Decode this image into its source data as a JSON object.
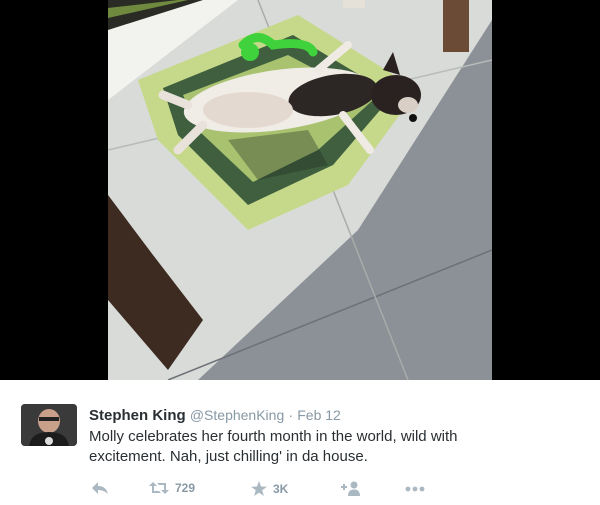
{
  "photo": {
    "description_icon": "photo-of-dog-sleeping-on-mat"
  },
  "tweet": {
    "author_name": "Stephen King",
    "author_handle": "@StephenKing",
    "separator": "·",
    "date": "Feb 12",
    "text_line1": "Molly celebrates her fourth month in the world, wild with",
    "text_line2": "excitement. Nah, just chilling' in da house.",
    "actions": {
      "reply_icon": "reply-icon",
      "retweet_icon": "retweet-icon",
      "retweet_count": "729",
      "favorite_icon": "star-icon",
      "favorite_count": "3K",
      "follow_icon": "follow-user-icon",
      "more_icon": "more-dots-icon"
    }
  },
  "colors": {
    "name": "#292f33",
    "meta": "#8899a6",
    "icon": "#aab8c2"
  }
}
